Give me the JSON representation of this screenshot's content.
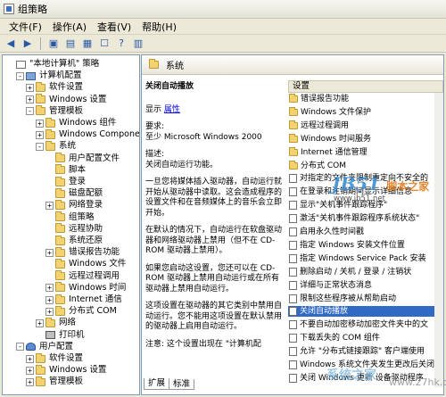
{
  "window": {
    "title": "组策略"
  },
  "menu": [
    "文件(F)",
    "操作(A)",
    "查看(V)",
    "帮助(H)"
  ],
  "toolbar": [
    "back-icon",
    "forward-icon",
    "up-icon",
    "show-hide-tree-icon",
    "export-list-icon",
    "properties-icon",
    "help-icon",
    "view-icon"
  ],
  "tree": [
    {
      "label": "\"本地计算机\" 策略",
      "icon": "doc",
      "indent": 0,
      "exp": ""
    },
    {
      "label": "计算机配置",
      "icon": "computer",
      "indent": 1,
      "exp": "-"
    },
    {
      "label": "软件设置",
      "icon": "folder",
      "indent": 2,
      "exp": "+"
    },
    {
      "label": "Windows 设置",
      "icon": "folder",
      "indent": 2,
      "exp": "+"
    },
    {
      "label": "管理模板",
      "icon": "folder",
      "indent": 2,
      "exp": "-"
    },
    {
      "label": "Windows 组件",
      "icon": "folder",
      "indent": 3,
      "exp": "+"
    },
    {
      "label": "Windows Componen",
      "icon": "folder",
      "indent": 3,
      "exp": "+"
    },
    {
      "label": "系统",
      "icon": "folder",
      "indent": 3,
      "exp": "-"
    },
    {
      "label": "用户配置文件",
      "icon": "folder",
      "indent": 4,
      "exp": ""
    },
    {
      "label": "脚本",
      "icon": "folder",
      "indent": 4,
      "exp": ""
    },
    {
      "label": "登录",
      "icon": "folder",
      "indent": 4,
      "exp": ""
    },
    {
      "label": "磁盘配额",
      "icon": "folder",
      "indent": 4,
      "exp": ""
    },
    {
      "label": "网络登录",
      "icon": "folder",
      "indent": 4,
      "exp": "+"
    },
    {
      "label": "组策略",
      "icon": "folder",
      "indent": 4,
      "exp": ""
    },
    {
      "label": "远程协助",
      "icon": "folder",
      "indent": 4,
      "exp": ""
    },
    {
      "label": "系统还原",
      "icon": "folder",
      "indent": 4,
      "exp": ""
    },
    {
      "label": "错误报告功能",
      "icon": "folder",
      "indent": 4,
      "exp": "+"
    },
    {
      "label": "Windows 文件",
      "icon": "folder",
      "indent": 4,
      "exp": ""
    },
    {
      "label": "远程过程调用",
      "icon": "folder",
      "indent": 4,
      "exp": ""
    },
    {
      "label": "Windows 时间",
      "icon": "folder",
      "indent": 4,
      "exp": "+"
    },
    {
      "label": "Internet 通信",
      "icon": "folder",
      "indent": 4,
      "exp": "+"
    },
    {
      "label": "分布式 COM",
      "icon": "folder",
      "indent": 4,
      "exp": "+"
    },
    {
      "label": "网络",
      "icon": "folder",
      "indent": 3,
      "exp": "+"
    },
    {
      "label": "打印机",
      "icon": "printer",
      "indent": 3,
      "exp": ""
    },
    {
      "label": "用户配置",
      "icon": "user",
      "indent": 1,
      "exp": "-"
    },
    {
      "label": "软件设置",
      "icon": "folder",
      "indent": 2,
      "exp": "+"
    },
    {
      "label": "Windows 设置",
      "icon": "folder",
      "indent": 2,
      "exp": "+"
    },
    {
      "label": "管理模板",
      "icon": "folder",
      "indent": 2,
      "exp": "+"
    }
  ],
  "right": {
    "header": "系统",
    "policy_title": "关闭自动播放",
    "display_label": "显示",
    "properties_link": "属性",
    "requirements": "要求:\n至少 Microsoft Windows 2000",
    "description_label": "描述:\n关闭自动运行功能。",
    "desc_para1": "一旦您将媒体插入驱动器，自动运行就开始从驱动器中读取。这会造成程序的设置文件和在音频媒体上的音乐会立即开始。",
    "desc_para2": "在默认的情况下，自动运行在软盘驱动器和网络驱动器上禁用（但不在 CD-ROM 驱动器上禁用）。",
    "desc_para3": "如果您启动这设置，您还可以在 CD-ROM 驱动器上禁用自动运行或在所有驱动器上禁用自动运行。",
    "desc_para4": "这项设置在驱动器的其它类别中禁用自动运行。您不能用这项设置在默认禁用的驱动器上启用自动运行。",
    "desc_para5": "注意: 这个设置出现在 \"计算机配"
  },
  "list": {
    "header": "设置",
    "rows": [
      {
        "label": "错误报告功能",
        "icon": "folder"
      },
      {
        "label": "Windows 文件保护",
        "icon": "folder"
      },
      {
        "label": "远程过程调用",
        "icon": "folder"
      },
      {
        "label": "Windows 时间服务",
        "icon": "folder"
      },
      {
        "label": "Internet 通信管理",
        "icon": "folder"
      },
      {
        "label": "分布式 COM",
        "icon": "folder"
      },
      {
        "label": "对指定的文件夹限制重定向不安全的",
        "icon": "doc"
      },
      {
        "label": "在登录和注销期间显示详细信息",
        "icon": "doc"
      },
      {
        "label": "显示\"关机事件跟踪程序\"",
        "icon": "doc"
      },
      {
        "label": "激活\"关机事件跟踪程序系统状态\"",
        "icon": "doc"
      },
      {
        "label": "启用永久性时间戳",
        "icon": "doc"
      },
      {
        "label": "指定 Windows 安装文件位置",
        "icon": "doc"
      },
      {
        "label": "指定 Windows Service Pack 安装",
        "icon": "doc"
      },
      {
        "label": "删除启动 / 关机 / 登录 / 注销状",
        "icon": "doc"
      },
      {
        "label": "详细与正常状态消息",
        "icon": "doc"
      },
      {
        "label": "限制这些程序被从帮助启动",
        "icon": "doc"
      },
      {
        "label": "关闭自动播放",
        "icon": "doc",
        "selected": true
      },
      {
        "label": "不要自动加密移动加密文件夹中的文",
        "icon": "doc"
      },
      {
        "label": "下载丢失的 COM 组件",
        "icon": "doc"
      },
      {
        "label": "允许 \"分布式链接跟踪\" 客户端使用",
        "icon": "doc"
      },
      {
        "label": "Windows 系统文件夹发生更改后关闭",
        "icon": "doc"
      },
      {
        "label": "关闭 Windows 更新 设备驱动程序",
        "icon": "doc"
      }
    ]
  },
  "tabs": [
    "扩展",
    "标准"
  ],
  "watermark": {
    "logo": "JB51",
    "logo_sub": "脚本之家",
    "site": "www.jb51.net",
    "bottom": "系统之家",
    "bottom_url": "www.27hk.com"
  }
}
